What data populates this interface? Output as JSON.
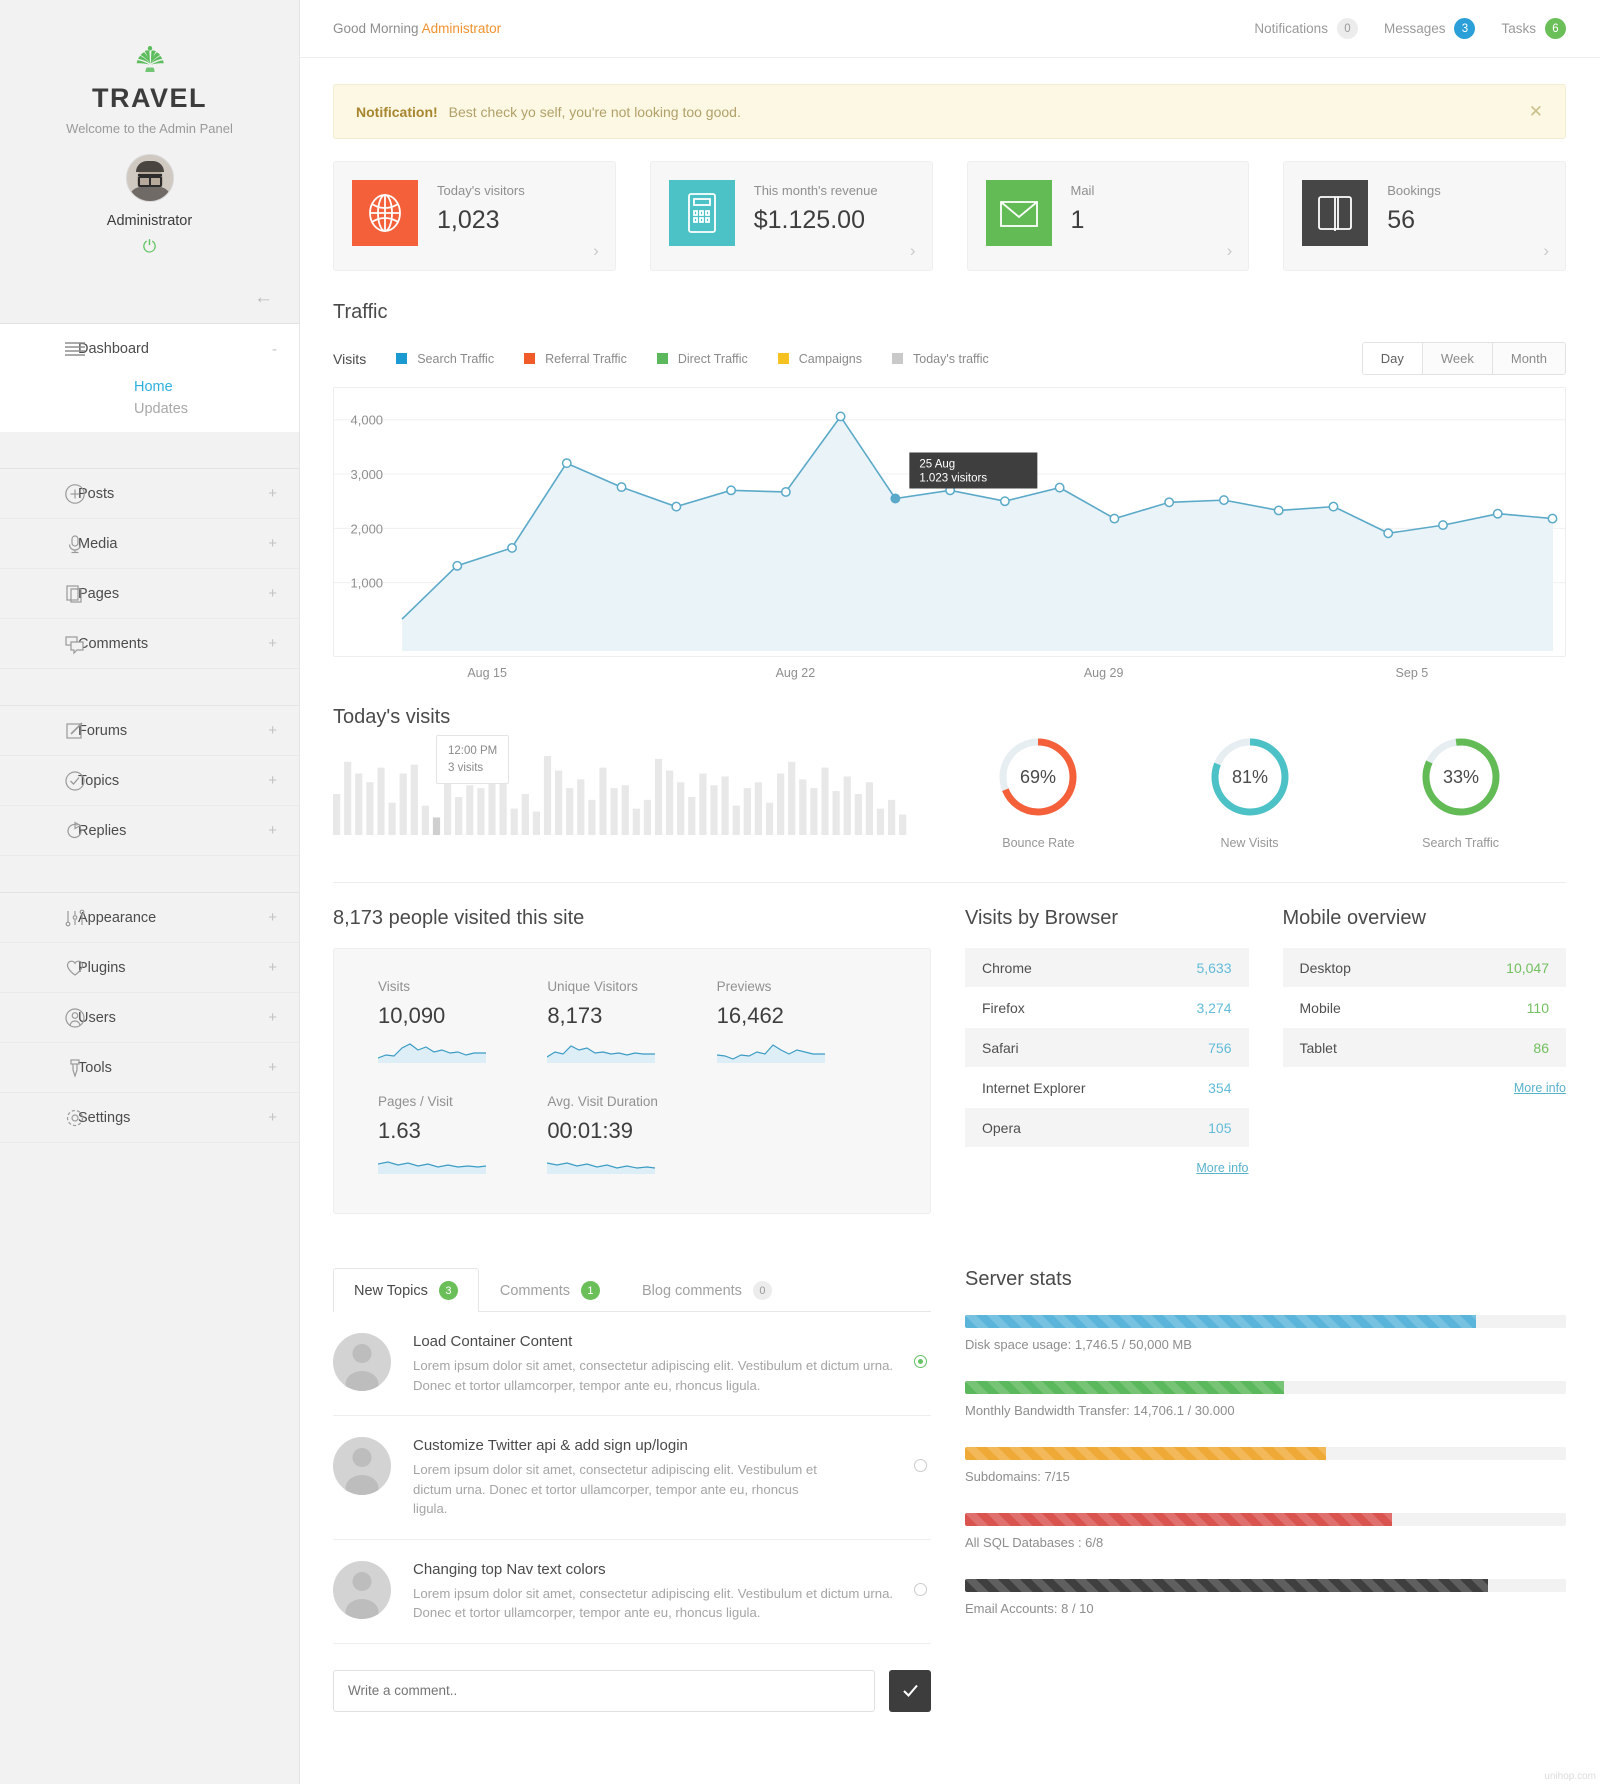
{
  "sidebar": {
    "brand": "TRAVEL",
    "tagline": "Welcome to the Admin Panel",
    "user_name": "Administrator",
    "power_icon": "power-icon",
    "collapse_icon": "arrow-left-icon",
    "dashboard": {
      "label": "Dashboard",
      "sub_items": [
        {
          "label": "Home",
          "state": "active"
        },
        {
          "label": "Updates",
          "state": "muted"
        }
      ]
    },
    "groups": [
      {
        "items": [
          {
            "label": "Posts",
            "icon": "plus-circle-icon",
            "expand": "+"
          },
          {
            "label": "Media",
            "icon": "microphone-icon",
            "expand": "+"
          },
          {
            "label": "Pages",
            "icon": "pages-icon",
            "expand": "+"
          },
          {
            "label": "Comments",
            "icon": "comments-icon",
            "expand": "+"
          }
        ]
      },
      {
        "items": [
          {
            "label": "Forums",
            "icon": "pencil-square-icon",
            "expand": "+"
          },
          {
            "label": "Topics",
            "icon": "check-circle-icon",
            "expand": "+"
          },
          {
            "label": "Replies",
            "icon": "reply-arrow-icon",
            "expand": "+"
          }
        ]
      },
      {
        "items": [
          {
            "label": "Appearance",
            "icon": "sliders-icon",
            "expand": "+"
          },
          {
            "label": "Plugins",
            "icon": "heart-icon",
            "expand": "+"
          },
          {
            "label": "Users",
            "icon": "user-icon",
            "expand": "+"
          },
          {
            "label": "Tools",
            "icon": "tools-icon",
            "expand": "+"
          },
          {
            "label": "Settings",
            "icon": "gear-icon",
            "expand": "+"
          }
        ]
      }
    ]
  },
  "topbar": {
    "greeting_prefix": "Good Morning ",
    "greeting_user": "Administrator",
    "links": [
      {
        "label": "Notifications",
        "count": "0",
        "style": "grey"
      },
      {
        "label": "Messages",
        "count": "3",
        "style": "blue"
      },
      {
        "label": "Tasks",
        "count": "6",
        "style": "green"
      }
    ]
  },
  "alert": {
    "title": "Notification!",
    "text": "Best check yo self, you're not looking too good.",
    "close_icon": "close-icon"
  },
  "stat_cards": [
    {
      "label": "Today's visitors",
      "value": "1,023",
      "icon": "globe-icon",
      "color": "#f4603a",
      "arrow": "chevron-right-icon"
    },
    {
      "label": "This month's revenue",
      "value": "$1.125.00",
      "icon": "calculator-icon",
      "color": "#4cc2c6",
      "arrow": "chevron-right-icon"
    },
    {
      "label": "Mail",
      "value": "1",
      "icon": "envelope-icon",
      "color": "#62bb55",
      "arrow": "chevron-right-icon"
    },
    {
      "label": "Bookings",
      "value": "56",
      "icon": "book-icon",
      "color": "#464646",
      "arrow": "chevron-right-icon"
    }
  ],
  "traffic": {
    "section_title": "Traffic",
    "legend_title": "Visits",
    "legend": [
      {
        "label": "Search Traffic",
        "color": "#1b9ad2"
      },
      {
        "label": "Referral Traffic",
        "color": "#f15a29"
      },
      {
        "label": "Direct Traffic",
        "color": "#5cb85c"
      },
      {
        "label": "Campaigns",
        "color": "#f5c221"
      },
      {
        "label": "Today's traffic",
        "color": "#c9c9c9"
      }
    ],
    "ranges": [
      {
        "label": "Day",
        "active": true
      },
      {
        "label": "Week",
        "active": false
      },
      {
        "label": "Month",
        "active": false
      }
    ],
    "tooltip": {
      "date": "25 Aug",
      "value": "1.023 visitors"
    }
  },
  "chart_data": [
    {
      "type": "line",
      "title": "Traffic",
      "xlabel": "",
      "ylabel": "",
      "ylim": [
        0,
        4400
      ],
      "yticks": [
        1000,
        2000,
        3000,
        4000
      ],
      "ytick_labels": [
        "1,000",
        "2,000",
        "3,000",
        "4,000"
      ],
      "xtick_labels": [
        "Aug 15",
        "Aug 22",
        "Aug 29",
        "Sep 5"
      ],
      "grid": true,
      "legend_position": "top-left",
      "series": [
        {
          "name": "Visits",
          "color": "#5aa9c8",
          "values": [
            330,
            1310,
            1640,
            3200,
            2760,
            2400,
            2700,
            2670,
            4060,
            2550,
            2700,
            2500,
            2750,
            2180,
            2480,
            2520,
            2330,
            2400,
            1910,
            2060,
            2270,
            2180
          ]
        }
      ]
    },
    {
      "type": "bar",
      "title": "Today's visits",
      "color": "#e8e8e8",
      "highlight_color": "#cfcfcf",
      "tooltip": {
        "time": "12:00 PM",
        "value": "3 visits"
      },
      "values": [
        14,
        25,
        21,
        18,
        23,
        11,
        21,
        24,
        10,
        6,
        22,
        13,
        17,
        16,
        26,
        19,
        9,
        14,
        8,
        27,
        22,
        16,
        19,
        12,
        23,
        16,
        17,
        9,
        12,
        26,
        22,
        18,
        13,
        21,
        17,
        20,
        10,
        16,
        18,
        11,
        21,
        25,
        19,
        16,
        23,
        15,
        20,
        14,
        18,
        9,
        12,
        7
      ]
    },
    {
      "type": "pie",
      "title": "Bounce Rate",
      "value": 69,
      "label": "69%",
      "caption": "Bounce Rate",
      "color": "#f4603a",
      "track_color": "#e6eef2"
    },
    {
      "type": "pie",
      "title": "New Visits",
      "value": 81,
      "label": "81%",
      "caption": "New Visits",
      "color": "#4cc2c6",
      "track_color": "#e6eef2"
    },
    {
      "type": "pie",
      "title": "Search Traffic",
      "value": 33,
      "label": "33%",
      "caption": "Search Traffic",
      "color": "#62bb55",
      "track_color": "#e6eef2"
    }
  ],
  "today_visits": {
    "title": "Today's visits",
    "tooltip": {
      "time": "12:00 PM",
      "value": "3 visits"
    }
  },
  "visitors_panel": {
    "heading": "8,173 people visited this site",
    "metrics": [
      {
        "label": "Visits",
        "value": "10,090"
      },
      {
        "label": "Unique Visitors",
        "value": "8,173"
      },
      {
        "label": "Previews",
        "value": "16,462"
      },
      {
        "label": "Pages / Visit",
        "value": "1.63"
      },
      {
        "label": "Avg. Visit Duration",
        "value": "00:01:39"
      }
    ]
  },
  "browsers": {
    "title": "Visits by Browser",
    "rows": [
      {
        "name": "Chrome",
        "value": "5,633"
      },
      {
        "name": "Firefox",
        "value": "3,274"
      },
      {
        "name": "Safari",
        "value": "756"
      },
      {
        "name": "Internet Explorer",
        "value": "354"
      },
      {
        "name": "Opera",
        "value": "105"
      }
    ],
    "more_label": "More info"
  },
  "mobile": {
    "title": "Mobile overview",
    "rows": [
      {
        "name": "Desktop",
        "value": "10,047"
      },
      {
        "name": "Mobile",
        "value": "110"
      },
      {
        "name": "Tablet",
        "value": "86"
      }
    ],
    "more_label": "More info"
  },
  "topics": {
    "tabs": [
      {
        "label": "New Topics",
        "count": "3",
        "style": "green",
        "active": true
      },
      {
        "label": "Comments",
        "count": "1",
        "style": "green",
        "active": false
      },
      {
        "label": "Blog comments",
        "count": "0",
        "style": "grey",
        "active": false
      }
    ],
    "items": [
      {
        "title": "Load Container Content",
        "text": "Lorem ipsum dolor sit amet, consectetur adipiscing elit. Vestibulum et dictum urna. Donec et tortor ullamcorper, tempor ante eu, rhoncus ligula.",
        "selected": true
      },
      {
        "title": "Customize Twitter api & add sign up/login",
        "text": "Lorem ipsum dolor sit amet, consectetur adipiscing elit. Vestibulum et dictum urna. Donec et tortor ullamcorper, tempor ante eu, rhoncus ligula.",
        "selected": false
      },
      {
        "title": "Changing top Nav text colors",
        "text": "Lorem ipsum dolor sit amet, consectetur adipiscing elit. Vestibulum et dictum urna. Donec et tortor ullamcorper, tempor ante eu, rhoncus ligula.",
        "selected": false
      }
    ],
    "comment_placeholder": "Write a comment..",
    "submit_icon": "check-icon"
  },
  "server_stats": {
    "title": "Server stats",
    "bars": [
      {
        "label": "Disk space usage: 1,746.5 / 50,000 MB",
        "percent": 85,
        "color": "#5bb5db"
      },
      {
        "label": "Monthly Bandwidth Transfer: 14,706.1 / 30.000",
        "percent": 53,
        "color": "#5cb85c"
      },
      {
        "label": "Subdomains: 7/15",
        "percent": 60,
        "color": "#efa937"
      },
      {
        "label": "All SQL Databases : 6/8",
        "percent": 71,
        "color": "#d9534f"
      },
      {
        "label": "Email Accounts: 8 / 10",
        "percent": 87,
        "color": "#3f3f3f"
      }
    ]
  },
  "watermark": "unihop.com"
}
